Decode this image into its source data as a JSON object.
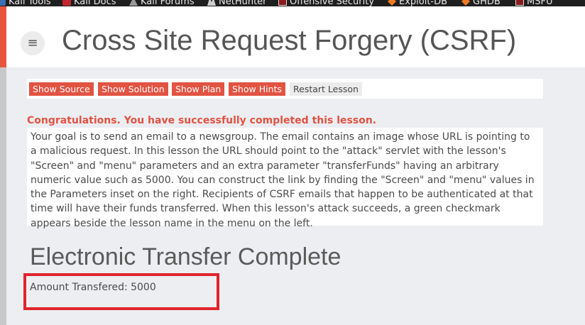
{
  "bookmarks": [
    {
      "label": "Kali Tools",
      "icon": "kali-icon"
    },
    {
      "label": "Kali Docs",
      "icon": "kali-docs-icon"
    },
    {
      "label": "Kali Forums",
      "icon": "kali-forums-icon"
    },
    {
      "label": "NetHunter",
      "icon": "nethunter-icon"
    },
    {
      "label": "Offensive Security",
      "icon": "offensive-security-icon"
    },
    {
      "label": "Exploit-DB",
      "icon": "exploit-db-icon"
    },
    {
      "label": "GHDB",
      "icon": "ghdb-icon"
    },
    {
      "label": "MSFU",
      "icon": "msfu-icon"
    }
  ],
  "header": {
    "title": "Cross Site Request Forgery (CSRF)"
  },
  "toolbar": {
    "buttons": [
      {
        "label": "Show Source"
      },
      {
        "label": "Show Solution"
      },
      {
        "label": "Show Plan"
      },
      {
        "label": "Show Hints"
      },
      {
        "label": "Restart Lesson"
      }
    ]
  },
  "lesson": {
    "congrats": "Congratulations. You have successfully completed this lesson.",
    "description": "Your goal is to send an email to a newsgroup. The email contains an image whose URL is pointing to a malicious request. In this lesson the URL should point to the \"attack\" servlet with the lesson's \"Screen\" and \"menu\" parameters and an extra parameter \"transferFunds\" having an arbitrary numeric value such as 5000. You can construct the link by finding the \"Screen\" and \"menu\" values in the Parameters inset on the right. Recipients of CSRF emails that happen to be authenticated at that time will have their funds transferred. When this lesson's attack succeeds, a green checkmark appears beside the lesson name in the menu on the left.",
    "transfer_title": "Electronic Transfer Complete",
    "amount_text": "Amount Transfered: 5000"
  },
  "colors": {
    "accent": "#e25342",
    "highlight": "#e0242c",
    "content_bg": "#eceef2"
  }
}
